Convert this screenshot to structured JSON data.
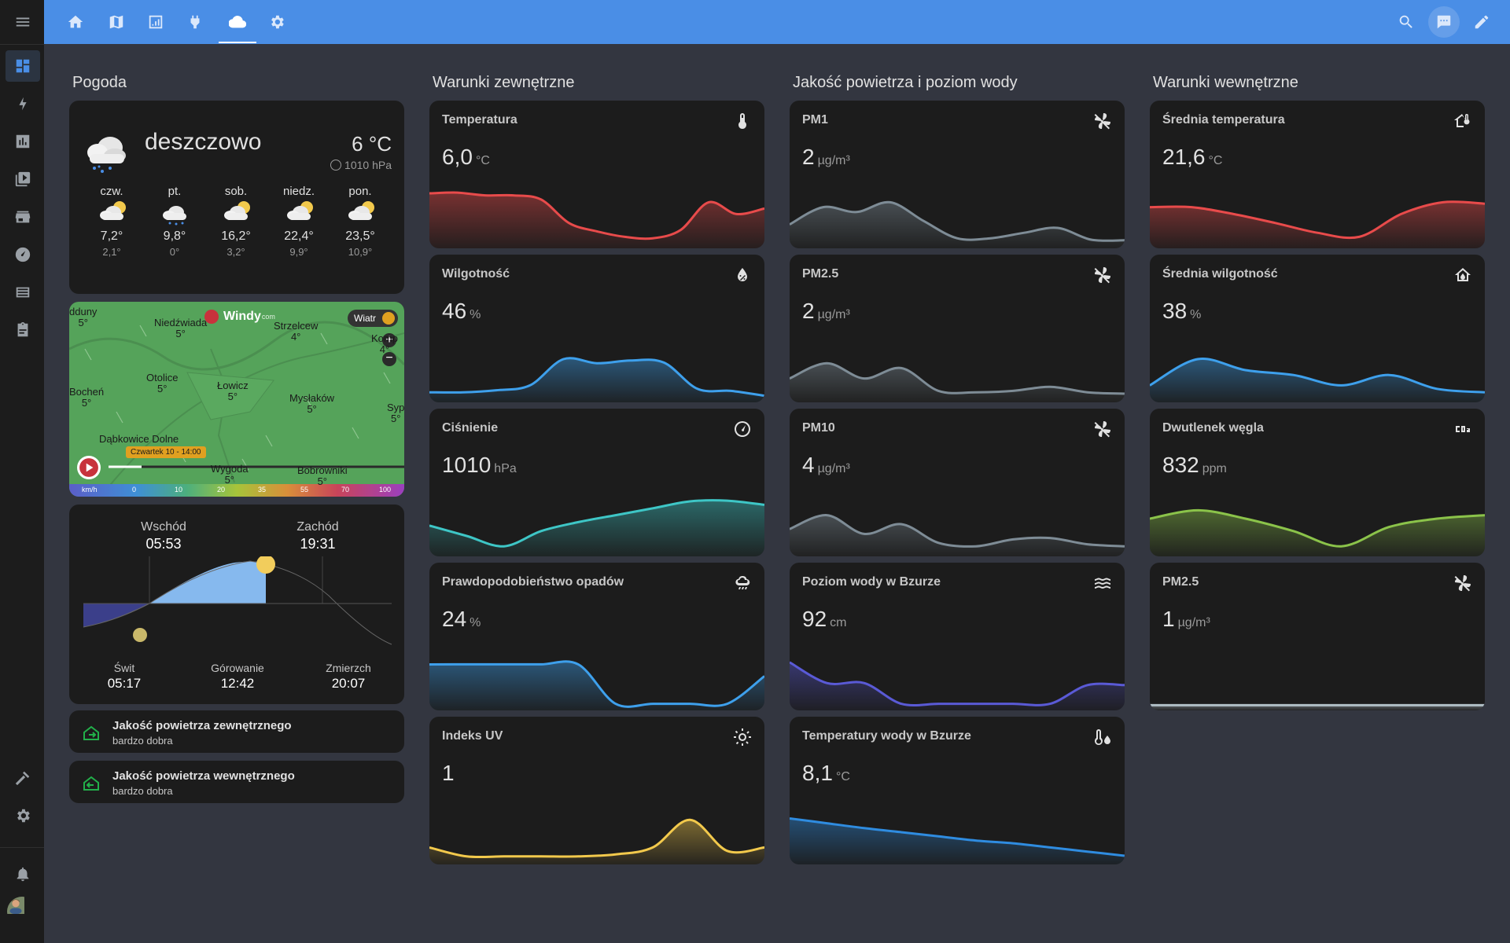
{
  "sidebar": {
    "icons": [
      "menu-icon",
      "dashboard-icon",
      "energy-icon",
      "history-icon",
      "media-icon",
      "store-icon",
      "speedometer-icon",
      "logbook-icon",
      "clipboard-icon",
      "hammer-icon",
      "settings-icon",
      "bell-icon"
    ]
  },
  "topbar": {
    "tabs": [
      "home-icon",
      "map-icon",
      "chart-icon",
      "plug-icon",
      "cloud-icon",
      "gear-icon"
    ],
    "actions": [
      "search-icon",
      "chat-icon",
      "edit-icon"
    ]
  },
  "columns": [
    "Pogoda",
    "Warunki zewnętrzne",
    "Jakość powietrza i poziom wody",
    "Warunki wewnętrzne"
  ],
  "weather": {
    "condition": "deszczowo",
    "temperature": "6 °C",
    "pressure": "1010 hPa",
    "forecast": [
      {
        "day": "czw.",
        "high": "7,2°",
        "low": "2,1°",
        "icon": "partly-cloudy"
      },
      {
        "day": "pt.",
        "high": "9,8°",
        "low": "0°",
        "icon": "rainy"
      },
      {
        "day": "sob.",
        "high": "16,2°",
        "low": "3,2°",
        "icon": "partly-cloudy"
      },
      {
        "day": "niedz.",
        "high": "22,4°",
        "low": "9,9°",
        "icon": "partly-cloudy"
      },
      {
        "day": "pon.",
        "high": "23,5°",
        "low": "10,9°",
        "icon": "partly-cloudy"
      }
    ]
  },
  "map": {
    "brand": "Windy",
    "brand_suffix": "com",
    "layer_label": "Wiatr",
    "time_label": "Czwartek 10 - 14:00",
    "legend_unit": "km/h",
    "legend_values": [
      "0",
      "10",
      "20",
      "35",
      "55",
      "70",
      "100"
    ],
    "places": [
      {
        "name": "Niedźwiada",
        "value": "5°"
      },
      {
        "name": "Strzelcew",
        "value": "4°"
      },
      {
        "name": "Otolice",
        "value": "5°"
      },
      {
        "name": "Łowicz",
        "value": "5°"
      },
      {
        "name": "Bocheń",
        "value": "5°"
      },
      {
        "name": "Mysłaków",
        "value": "5°"
      },
      {
        "name": "Dąbkowice Dolne",
        "value": ""
      },
      {
        "name": "Wygoda",
        "value": "5°"
      },
      {
        "name": "Bobrowniki",
        "value": "5°"
      },
      {
        "name": "Komp",
        "value": "4°"
      },
      {
        "name": "Syp",
        "value": "5°"
      },
      {
        "name": "dduny",
        "value": "5°"
      }
    ]
  },
  "sun": {
    "sunrise_label": "Wschód",
    "sunrise": "05:53",
    "sunset_label": "Zachód",
    "sunset": "19:31",
    "dawn_label": "Świt",
    "dawn": "05:17",
    "noon_label": "Górowanie",
    "noon": "12:42",
    "dusk_label": "Zmierzch",
    "dusk": "20:07"
  },
  "air_quality": [
    {
      "title": "Jakość powietrza zewnętrznego",
      "state": "bardzo dobra"
    },
    {
      "title": "Jakość powietrza wewnętrznego",
      "state": "bardzo dobra"
    }
  ],
  "sensors": {
    "outdoor": [
      {
        "name": "Temperatura",
        "value": "6,0",
        "unit": "°C",
        "icon": "thermometer-icon",
        "color": "#e84b4b",
        "series": [
          0.75,
          0.76,
          0.72,
          0.72,
          0.66,
          0.32,
          0.2,
          0.12,
          0.1,
          0.22,
          0.62,
          0.45,
          0.53
        ]
      },
      {
        "name": "Wilgotność",
        "value": "46",
        "unit": "%",
        "icon": "water-percent-icon",
        "color": "#3ea0ec",
        "series": [
          0.1,
          0.1,
          0.13,
          0.2,
          0.58,
          0.52,
          0.56,
          0.53,
          0.15,
          0.12,
          0.05
        ]
      },
      {
        "name": "Ciśnienie",
        "value": "1010",
        "unit": "hPa",
        "icon": "gauge-icon",
        "color": "#3ec6c6",
        "series": [
          0.4,
          0.25,
          0.1,
          0.32,
          0.45,
          0.55,
          0.65,
          0.75,
          0.76,
          0.7
        ]
      },
      {
        "name": "Prawdopodobieństwo opadów",
        "value": "24",
        "unit": "%",
        "icon": "weather-rainy-icon",
        "color": "#3ea0ec",
        "series": [
          0.62,
          0.62,
          0.62,
          0.62,
          0.62,
          0.05,
          0.05,
          0.05,
          0.05,
          0.45
        ]
      },
      {
        "name": "Indeks UV",
        "value": "1",
        "unit": "",
        "icon": "sun-icon",
        "color": "#f2c94c",
        "series": [
          0.2,
          0.07,
          0.07,
          0.07,
          0.07,
          0.1,
          0.2,
          0.6,
          0.15,
          0.2
        ]
      }
    ],
    "air_water": [
      {
        "name": "PM1",
        "value": "2",
        "unit": "µg/m³",
        "icon": "fan-icon",
        "color": "#7e8c96",
        "series": [
          0.3,
          0.55,
          0.48,
          0.62,
          0.35,
          0.1,
          0.1,
          0.18,
          0.25,
          0.08,
          0.07
        ]
      },
      {
        "name": "PM2.5",
        "value": "2",
        "unit": "µg/m³",
        "icon": "fan-icon",
        "color": "#7e8c96",
        "series": [
          0.3,
          0.52,
          0.3,
          0.45,
          0.12,
          0.1,
          0.12,
          0.18,
          0.1,
          0.08
        ]
      },
      {
        "name": "PM10",
        "value": "4",
        "unit": "µg/m³",
        "icon": "fan-icon",
        "color": "#7e8c96",
        "series": [
          0.35,
          0.55,
          0.28,
          0.42,
          0.15,
          0.1,
          0.2,
          0.22,
          0.13,
          0.1
        ]
      },
      {
        "name": "Poziom wody w Bzurze",
        "value": "92",
        "unit": "cm",
        "icon": "waves-icon",
        "color": "#5a5ad6",
        "series": [
          0.65,
          0.35,
          0.35,
          0.05,
          0.05,
          0.05,
          0.05,
          0.05,
          0.32,
          0.32
        ]
      },
      {
        "name": "Temperatury wody w Bzurze",
        "value": "8,1",
        "unit": "°C",
        "icon": "thermometer-water-icon",
        "color": "#2f8ce0",
        "series": [
          0.62,
          0.55,
          0.48,
          0.42,
          0.36,
          0.3,
          0.26,
          0.2,
          0.14,
          0.08
        ]
      }
    ],
    "indoor": [
      {
        "name": "Średnia temperatura",
        "value": "21,6",
        "unit": "°C",
        "icon": "home-thermometer-icon",
        "color": "#e84b4b",
        "series": [
          0.55,
          0.55,
          0.45,
          0.32,
          0.18,
          0.12,
          0.45,
          0.62,
          0.6
        ]
      },
      {
        "name": "Średnia wilgotność",
        "value": "38",
        "unit": "%",
        "icon": "home-water-icon",
        "color": "#3ea0ec",
        "series": [
          0.2,
          0.58,
          0.42,
          0.35,
          0.2,
          0.35,
          0.15,
          0.1
        ]
      },
      {
        "name": "Dwutlenek węgla",
        "value": "832",
        "unit": "ppm",
        "icon": "co2-icon",
        "color": "#8bc34a",
        "series": [
          0.5,
          0.62,
          0.5,
          0.32,
          0.1,
          0.38,
          0.5,
          0.55
        ]
      },
      {
        "name": "PM2.5",
        "value": "1",
        "unit": "µg/m³",
        "icon": "fan-icon",
        "color": "#b0bec5",
        "series": [
          0.03,
          0.03,
          0.03,
          0.03,
          0.03
        ]
      }
    ]
  }
}
